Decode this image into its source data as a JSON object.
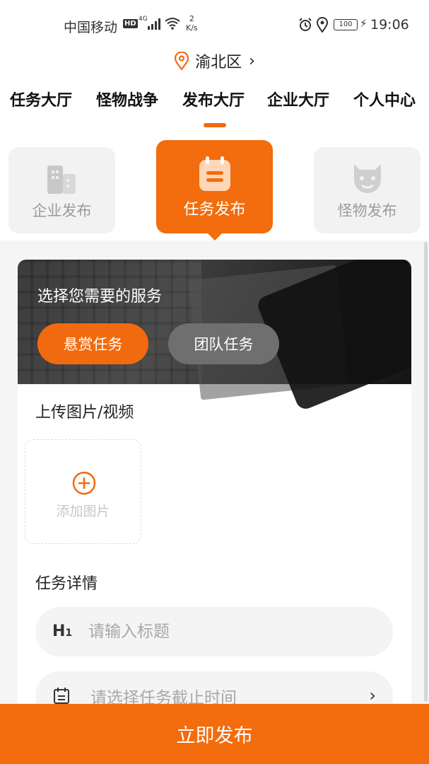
{
  "status_bar": {
    "carrier": "中国移动",
    "hd": "HD",
    "network": "4G",
    "speed_value": "2",
    "speed_unit": "K/s",
    "battery": "100",
    "time": "19:06"
  },
  "location": {
    "label": "渝北区"
  },
  "nav": {
    "tabs": [
      {
        "label": "任务大厅"
      },
      {
        "label": "怪物战争"
      },
      {
        "label": "发布大厅"
      },
      {
        "label": "企业大厅"
      },
      {
        "label": "个人中心"
      }
    ],
    "active_index": 2
  },
  "categories": [
    {
      "label": "企业发布",
      "icon": "building-icon"
    },
    {
      "label": "任务发布",
      "icon": "clipboard-icon"
    },
    {
      "label": "怪物发布",
      "icon": "monster-icon"
    }
  ],
  "service": {
    "title": "选择您需要的服务",
    "options": [
      {
        "label": "悬赏任务",
        "selected": true
      },
      {
        "label": "团队任务",
        "selected": false
      }
    ]
  },
  "upload": {
    "title": "上传图片/视频",
    "add_label": "添加图片"
  },
  "details": {
    "title": "任务详情",
    "title_placeholder": "请输入标题",
    "deadline_placeholder": "请选择任务截止时间"
  },
  "submit_label": "立即发布",
  "colors": {
    "accent": "#f36c0d",
    "inactive_card": "#f2f2f2"
  }
}
